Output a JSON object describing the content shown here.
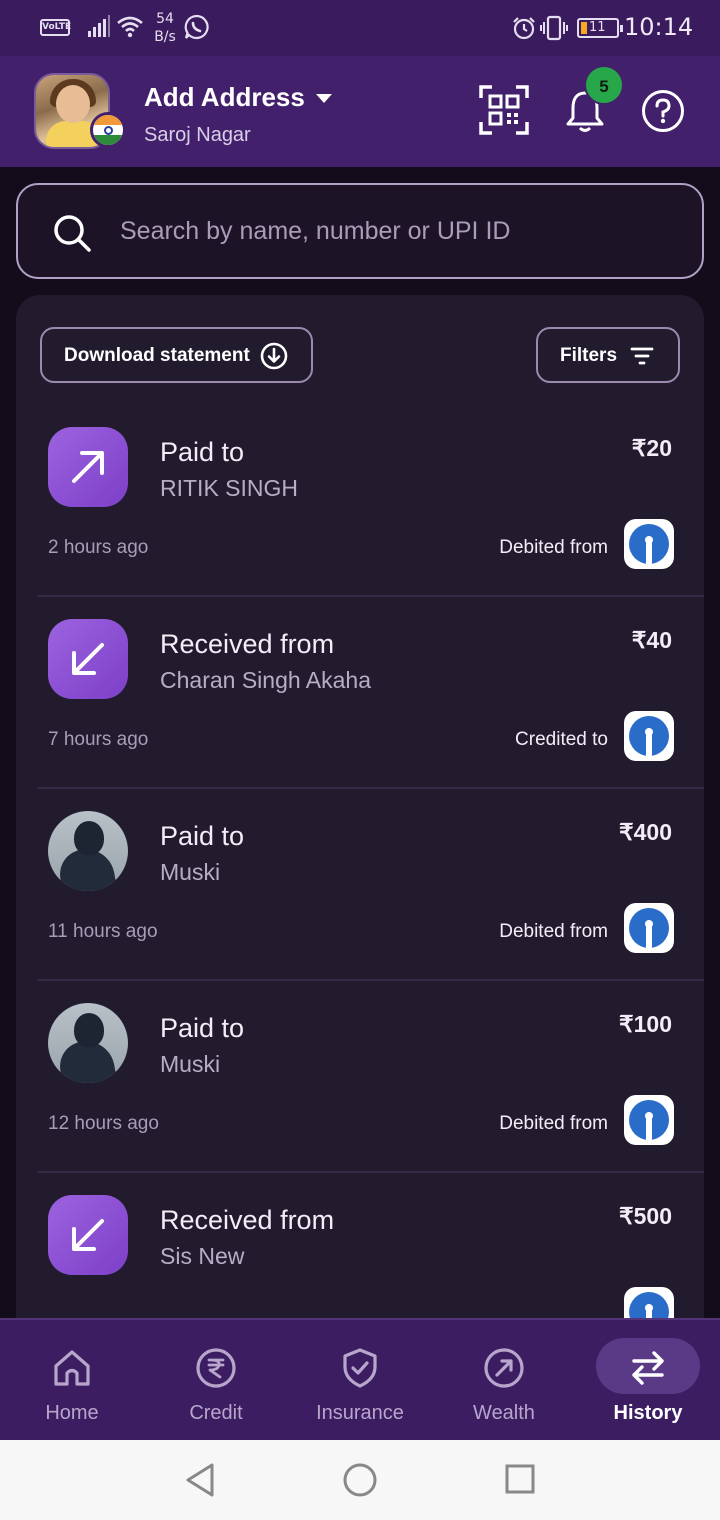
{
  "status_bar": {
    "volte": "VoLTE",
    "speed_value": "54",
    "speed_unit": "B/s",
    "battery": "11",
    "time": "10:14"
  },
  "header": {
    "title": "Add Address",
    "subtitle": "Saroj Nagar",
    "notification_count": "5"
  },
  "search": {
    "placeholder": "Search by name, number or UPI ID"
  },
  "toolbar": {
    "download_label": "Download statement",
    "filters_label": "Filters"
  },
  "transactions": [
    {
      "type": "Paid to",
      "name": "RITIK SINGH",
      "amount": "₹20",
      "time": "2 hours ago",
      "account_label": "Debited from",
      "direction": "out",
      "avatar": "arrow-up-right-icon"
    },
    {
      "type": "Received from",
      "name": "Charan Singh Akaha",
      "amount": "₹40",
      "time": "7 hours ago",
      "account_label": "Credited to",
      "direction": "in",
      "avatar": "arrow-down-left-icon"
    },
    {
      "type": "Paid to",
      "name": "Muski",
      "amount": "₹400",
      "time": "11 hours ago",
      "account_label": "Debited from",
      "direction": "out",
      "avatar": "photo"
    },
    {
      "type": "Paid to",
      "name": "Muski",
      "amount": "₹100",
      "time": "12 hours ago",
      "account_label": "Debited from",
      "direction": "out",
      "avatar": "photo"
    },
    {
      "type": "Received from",
      "name": "Sis New",
      "amount": "₹500",
      "time": "",
      "account_label": "",
      "direction": "in",
      "avatar": "arrow-down-left-icon"
    }
  ],
  "bottom_nav": [
    {
      "label": "Home",
      "icon": "home-icon",
      "active": false
    },
    {
      "label": "Credit",
      "icon": "rupee-icon",
      "active": false
    },
    {
      "label": "Insurance",
      "icon": "shield-check-icon",
      "active": false
    },
    {
      "label": "Wealth",
      "icon": "wealth-icon",
      "active": false
    },
    {
      "label": "History",
      "icon": "swap-icon",
      "active": true
    }
  ],
  "colors": {
    "header_bg": "#43206b",
    "card_bg": "#221b2e",
    "accent_purple": "#8b4fd6",
    "badge_green": "#27a74a",
    "bank_blue": "#2a6dc9"
  }
}
